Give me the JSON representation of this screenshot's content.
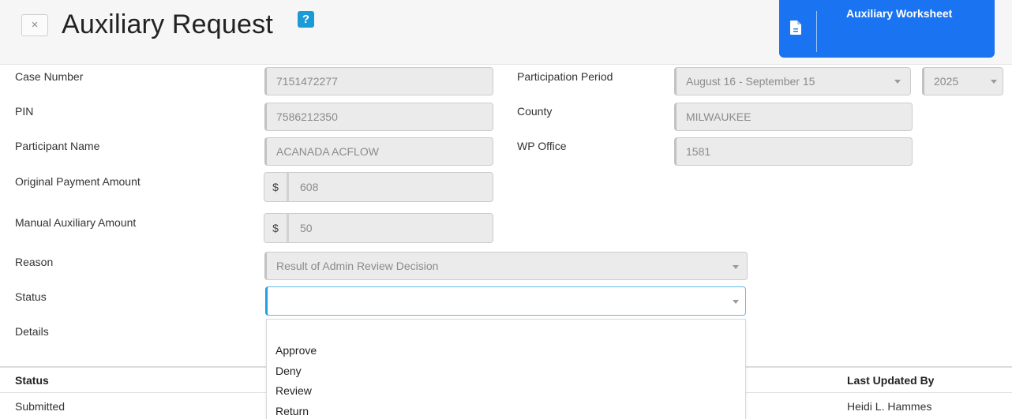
{
  "header": {
    "close_label": "×",
    "title": "Auxiliary Request",
    "help_label": "?",
    "worksheet_button": "Auxiliary Worksheet"
  },
  "form": {
    "case_number": {
      "label": "Case Number",
      "value": "7151472277"
    },
    "pin": {
      "label": "PIN",
      "value": "7586212350"
    },
    "participant_name": {
      "label": "Participant Name",
      "value": "ACANADA ACFLOW"
    },
    "original_payment": {
      "label": "Original Payment Amount",
      "currency": "$",
      "value": "608"
    },
    "manual_auxiliary": {
      "label": "Manual Auxiliary Amount",
      "currency": "$",
      "value": "50"
    },
    "participation_period": {
      "label": "Participation Period",
      "value": "August 16 - September 15",
      "year": "2025"
    },
    "county": {
      "label": "County",
      "value": "MILWAUKEE"
    },
    "wp_office": {
      "label": "WP Office",
      "value": "1581"
    },
    "reason": {
      "label": "Reason",
      "value": "Result of Admin Review Decision"
    },
    "status": {
      "label": "Status",
      "value": ""
    },
    "details": {
      "label": "Details"
    }
  },
  "status_dropdown": {
    "options": [
      "",
      "Approve",
      "Deny",
      "Review",
      "Return"
    ]
  },
  "history_table": {
    "headers": {
      "status": "Status",
      "last_updated_by": "Last Updated By"
    },
    "rows": [
      {
        "status": "Submitted",
        "last_updated_by": "Heidi L. Hammes"
      }
    ]
  },
  "colors": {
    "accent": "#1a73f0",
    "help": "#1a9ad6",
    "focus_border": "#22a0dc"
  }
}
